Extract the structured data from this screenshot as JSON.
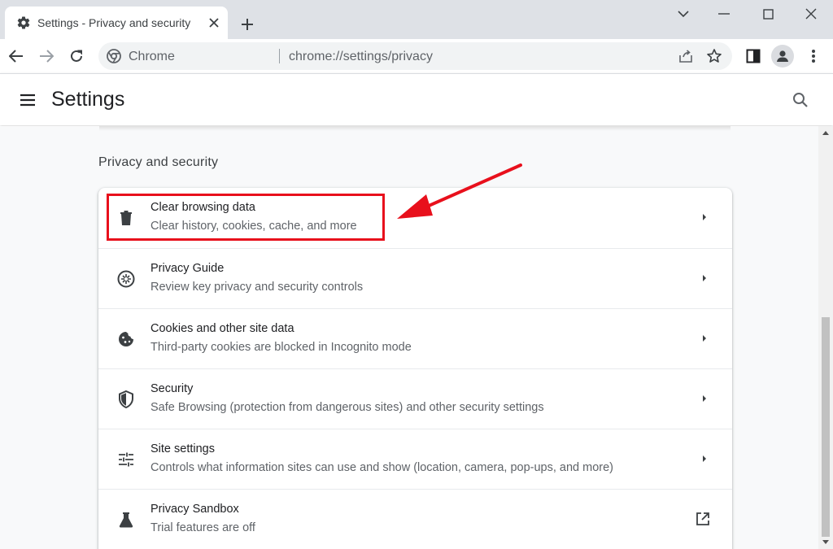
{
  "browser": {
    "tab": {
      "title": "Settings - Privacy and security",
      "icon": "gear-icon"
    },
    "omnibox": {
      "site_label": "Chrome",
      "url": "chrome://settings/privacy"
    }
  },
  "header": {
    "title": "Settings"
  },
  "section": {
    "title": "Privacy and security"
  },
  "rows": [
    {
      "title": "Clear browsing data",
      "subtitle": "Clear history, cookies, cache, and more",
      "icon": "trash-icon",
      "action": "chevron-right-icon"
    },
    {
      "title": "Privacy Guide",
      "subtitle": "Review key privacy and security controls",
      "icon": "compass-icon",
      "action": "chevron-right-icon"
    },
    {
      "title": "Cookies and other site data",
      "subtitle": "Third-party cookies are blocked in Incognito mode",
      "icon": "cookie-icon",
      "action": "chevron-right-icon"
    },
    {
      "title": "Security",
      "subtitle": "Safe Browsing (protection from dangerous sites) and other security settings",
      "icon": "shield-icon",
      "action": "chevron-right-icon"
    },
    {
      "title": "Site settings",
      "subtitle": "Controls what information sites can use and show (location, camera, pop-ups, and more)",
      "icon": "tune-icon",
      "action": "chevron-right-icon"
    },
    {
      "title": "Privacy Sandbox",
      "subtitle": "Trial features are off",
      "icon": "flask-icon",
      "action": "open-external-icon"
    }
  ],
  "colors": {
    "annotation": "#e8101c",
    "tabstrip": "#dee1e6",
    "content_bg": "#f8f9fa"
  }
}
